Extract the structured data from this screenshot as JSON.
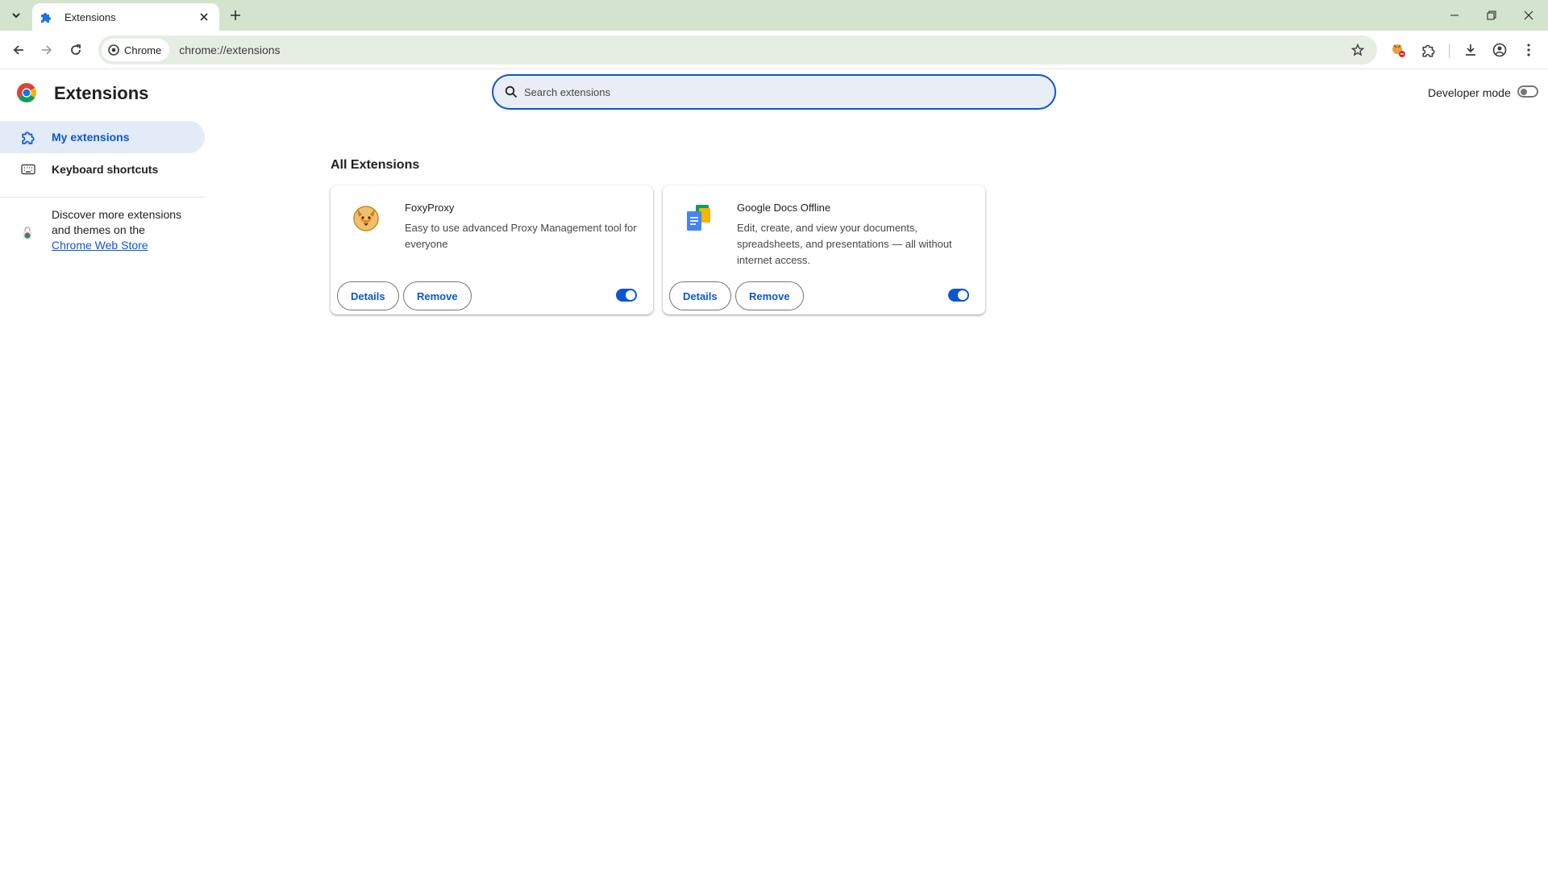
{
  "browser": {
    "tab": {
      "title": "Extensions",
      "favicon": "puzzle-icon"
    },
    "chip_label": "Chrome",
    "url": "chrome://extensions"
  },
  "header": {
    "title": "Extensions",
    "search_placeholder": "Search extensions",
    "developer_mode_label": "Developer mode",
    "developer_mode_on": false
  },
  "sidebar": {
    "items": [
      {
        "label": "My extensions",
        "icon": "extensions-icon",
        "active": true
      },
      {
        "label": "Keyboard shortcuts",
        "icon": "keyboard-icon",
        "active": false
      }
    ],
    "discover": {
      "line1": "Discover more extensions",
      "line2": "and themes on the",
      "link": "Chrome Web Store"
    }
  },
  "section_title": "All Extensions",
  "extensions": [
    {
      "name": "FoxyProxy",
      "description": "Easy to use advanced Proxy Management tool for everyone",
      "details_label": "Details",
      "remove_label": "Remove",
      "enabled": true
    },
    {
      "name": "Google Docs Offline",
      "description": "Edit, create, and view your documents, spreadsheets, and presentations — all without internet access.",
      "details_label": "Details",
      "remove_label": "Remove",
      "enabled": true
    }
  ],
  "colors": {
    "accent": "#0b57d0",
    "tabstrip": "#d3e3cd",
    "active_nav": "#e3eaf8"
  }
}
